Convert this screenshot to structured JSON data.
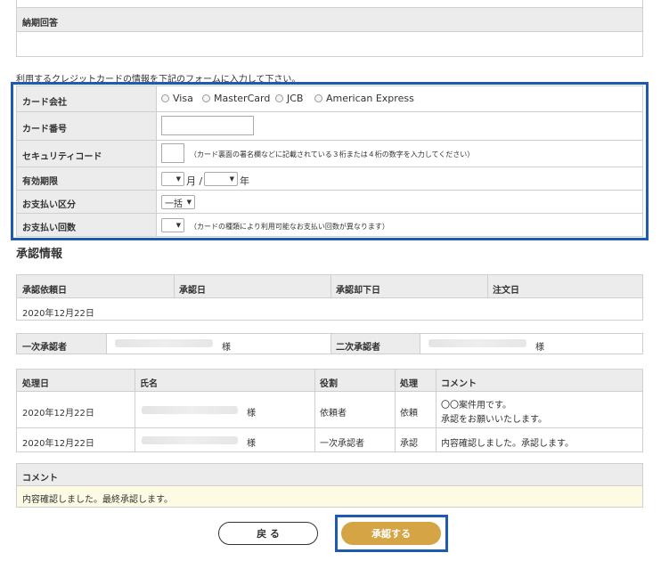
{
  "delivery_reply": {
    "label": "納期回答"
  },
  "card_form": {
    "instruction": "利用するクレジットカードの情報を下記のフォームに入力して下さい。",
    "labels": {
      "company": "カード会社",
      "number": "カード番号",
      "security": "セキュリティコード",
      "expiry": "有効期限",
      "pay_type": "お支払い区分",
      "pay_count": "お支払い回数"
    },
    "companies": [
      "Visa",
      "MasterCard",
      "JCB",
      "American Express"
    ],
    "security_note": "（カード裏面の署名欄などに記載されている３桁または４桁の数字を入力してください）",
    "expiry_month_unit": "月 /",
    "expiry_year_unit": "年",
    "pay_type_value": "一括",
    "pay_count_note": "（カードの種類により利用可能なお支払い回数が異なります）"
  },
  "approval": {
    "title": "承認情報",
    "dates_header": [
      "承認依頼日",
      "承認日",
      "承認却下日",
      "注文日"
    ],
    "dates_values": [
      "2020年12月22日",
      "",
      "",
      ""
    ],
    "first_approver_label": "一次承認者",
    "second_approver_label": "二次承認者",
    "honorific": "様",
    "history_header": [
      "処理日",
      "氏名",
      "役割",
      "処理",
      "コメント"
    ],
    "history_rows": [
      {
        "date": "2020年12月22日",
        "honorific": "様",
        "role": "依頼者",
        "action": "依頼",
        "comment_line1": "〇〇案件用です。",
        "comment_line2": "承認をお願いいたします。"
      },
      {
        "date": "2020年12月22日",
        "honorific": "様",
        "role": "一次承認者",
        "action": "承認",
        "comment_line1": "内容確認しました。承認します。",
        "comment_line2": ""
      }
    ],
    "comment_label": "コメント",
    "comment_value": "内容確認しました。最終承認します。"
  },
  "buttons": {
    "back": "戻 る",
    "approve": "承認する"
  },
  "colors": {
    "highlight": "#1e5ab0",
    "approve_button": "#d4a445",
    "comment_bg": "#fdfbe3"
  }
}
